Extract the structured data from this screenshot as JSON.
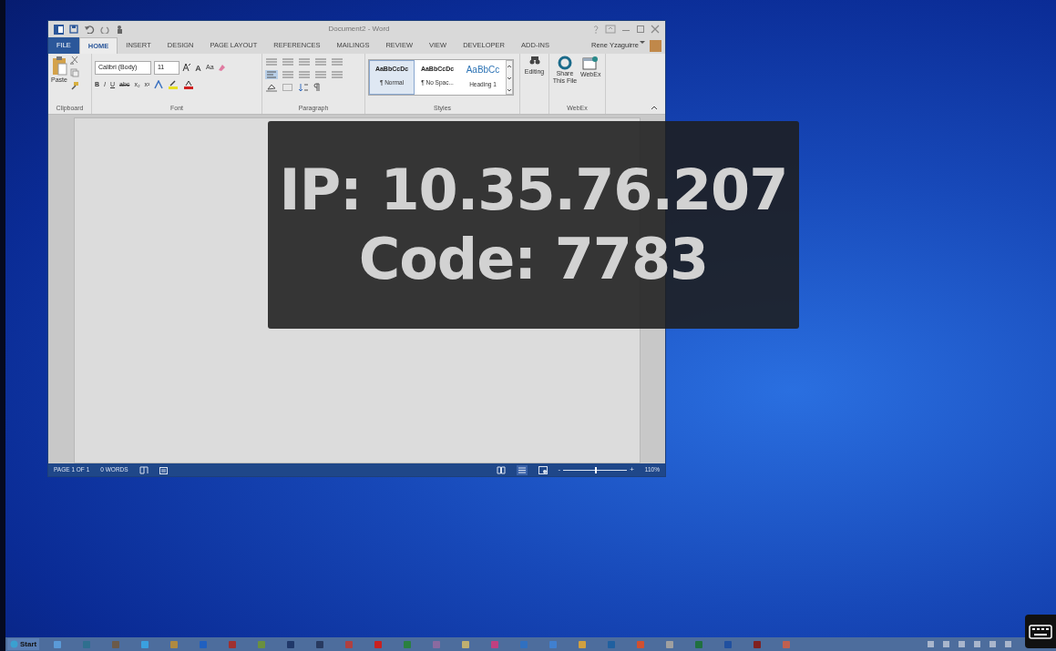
{
  "word_window": {
    "title": "Document2 - Word",
    "tabs": [
      {
        "label": "FILE",
        "kind": "backstage",
        "selected": false
      },
      {
        "label": "HOME",
        "kind": "tab",
        "selected": true
      },
      {
        "label": "INSERT",
        "kind": "tab",
        "selected": false
      },
      {
        "label": "DESIGN",
        "kind": "tab",
        "selected": false
      },
      {
        "label": "PAGE LAYOUT",
        "kind": "tab",
        "selected": false
      },
      {
        "label": "REFERENCES",
        "kind": "tab",
        "selected": false
      },
      {
        "label": "MAILINGS",
        "kind": "tab",
        "selected": false
      },
      {
        "label": "REVIEW",
        "kind": "tab",
        "selected": false
      },
      {
        "label": "VIEW",
        "kind": "tab",
        "selected": false
      },
      {
        "label": "DEVELOPER",
        "kind": "tab",
        "selected": false
      },
      {
        "label": "ADD-INS",
        "kind": "tab",
        "selected": false
      }
    ],
    "user": "Rene Yzaguirre",
    "ribbon": {
      "clipboard": {
        "paste": "Paste",
        "label": "Clipboard"
      },
      "font": {
        "name": "Calibri (Body)",
        "size": "11",
        "change_case": "Aa",
        "format_buttons": [
          "B",
          "I",
          "U",
          "abc",
          "x₂",
          "x²"
        ],
        "label": "Font"
      },
      "paragraph": {
        "label": "Paragraph"
      },
      "styles": {
        "items": [
          {
            "preview": "AaBbCcDc",
            "name": "¶ Normal",
            "kind": "body",
            "selected": true
          },
          {
            "preview": "AaBbCcDc",
            "name": "¶ No Spac...",
            "kind": "body",
            "selected": false
          },
          {
            "preview": "AaBbCc",
            "name": "Heading 1",
            "kind": "heading",
            "selected": false
          }
        ],
        "label": "Styles"
      },
      "editing": {
        "label": "Editing"
      },
      "webex": {
        "share": "Share This File",
        "webex": "WebEx",
        "label": "WebEx"
      }
    },
    "status_bar": {
      "page": "PAGE 1 OF 1",
      "words": "0 WORDS",
      "zoom": {
        "out": "-",
        "in": "+",
        "level": 0.5,
        "reading": "110%"
      }
    }
  },
  "overlay": {
    "lines": [
      "IP: 10.35.76.207",
      "Code: 7783"
    ]
  },
  "taskbar": {
    "start": "Start",
    "apps": [
      {
        "color": "#5a9ad8"
      },
      {
        "color": "#2f6f8f"
      },
      {
        "color": "#6b5a4a"
      },
      {
        "color": "#3aa0e0"
      },
      {
        "color": "#b08a40"
      },
      {
        "color": "#2060c0"
      },
      {
        "color": "#a03030"
      },
      {
        "color": "#6a9040"
      },
      {
        "color": "#20386a"
      },
      {
        "color": "#283a60"
      },
      {
        "color": "#b04040"
      },
      {
        "color": "#c82020"
      },
      {
        "color": "#2a8040"
      },
      {
        "color": "#8a6aa0"
      },
      {
        "color": "#c0b070"
      },
      {
        "color": "#c04080"
      },
      {
        "color": "#3070c0"
      },
      {
        "color": "#4080d0"
      },
      {
        "color": "#d0a040"
      },
      {
        "color": "#2060a0"
      },
      {
        "color": "#d05030"
      },
      {
        "color": "#a0a0a0"
      },
      {
        "color": "#207040"
      },
      {
        "color": "#2050a0"
      },
      {
        "color": "#802020"
      },
      {
        "color": "#c06050"
      }
    ]
  }
}
